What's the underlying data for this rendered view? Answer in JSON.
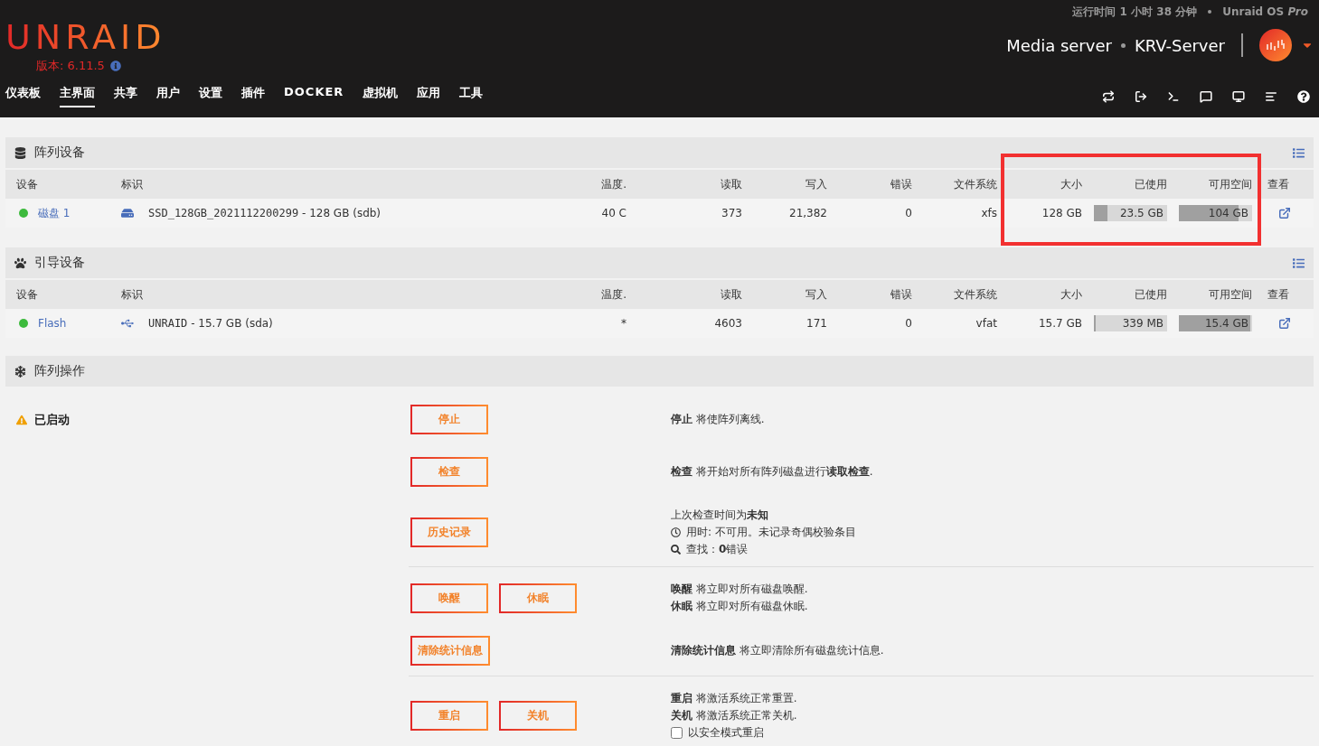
{
  "header": {
    "uptime": "运行时间 1 小时 38 分钟",
    "edition": "Unraid OS ",
    "edition_tier": "Pro",
    "logo": "UNRAID",
    "version": "版本: 6.11.5",
    "server_description": "Media server",
    "server_name": "KRV-Server"
  },
  "nav": [
    {
      "label": "仪表板",
      "selected": false
    },
    {
      "label": "主界面",
      "selected": true
    },
    {
      "label": "共享",
      "selected": false
    },
    {
      "label": "用户",
      "selected": false
    },
    {
      "label": "设置",
      "selected": false
    },
    {
      "label": "插件",
      "selected": false
    },
    {
      "label": "DOCKER",
      "selected": false
    },
    {
      "label": "虚拟机",
      "selected": false
    },
    {
      "label": "应用",
      "selected": false
    },
    {
      "label": "工具",
      "selected": false
    }
  ],
  "sections": [
    {
      "title": "阵列设备",
      "kind": "array",
      "highlighted": true,
      "columns": [
        "设备",
        "标识",
        "温度.",
        "读取",
        "写入",
        "错误",
        "文件系统",
        "大小",
        "已使用",
        "可用空间",
        "查看"
      ],
      "rows": [
        {
          "device": "磁盘 1",
          "color": "#3dba3d",
          "kind": "ssd",
          "identity": "SSD_128GB_2021112200299",
          "identity_suffix": " - 128 GB (sdb)",
          "temp": "40 C",
          "reads": "373",
          "writes": "21,382",
          "errors": "0",
          "fs": "xfs",
          "size": "128 GB",
          "used": {
            "text": "23.5 GB",
            "level": 0.18
          },
          "free": {
            "text": "104 GB",
            "level": 0.81
          }
        }
      ]
    },
    {
      "title": "引导设备",
      "kind": "boot",
      "highlighted": false,
      "columns": [
        "设备",
        "标识",
        "温度.",
        "读取",
        "写入",
        "错误",
        "文件系统",
        "大小",
        "已使用",
        "可用空间",
        "查看"
      ],
      "rows": [
        {
          "device": "Flash",
          "color": "#3dba3d",
          "kind": "usb",
          "identity": "UNRAID",
          "identity_suffix": " - 15.7 GB (sda)",
          "temp": "*",
          "reads": "4603",
          "writes": "171",
          "errors": "0",
          "fs": "vfat",
          "size": "15.7 GB",
          "used": {
            "text": "339 MB",
            "level": 0.02
          },
          "free": {
            "text": "15.4 GB",
            "level": 0.98
          }
        }
      ]
    }
  ],
  "operations": {
    "title": "阵列操作",
    "status": "已启动",
    "groups": [
      {
        "rows": [
          {
            "buttons": [
              "停止"
            ],
            "lines": [
              {
                "kind": "text",
                "text": "**停止** 将使阵列离线."
              }
            ]
          },
          {
            "buttons": [
              "检查"
            ],
            "lines": [
              {
                "kind": "text",
                "text": "**检查** 将开始对所有阵列磁盘进行**读取检查**."
              }
            ]
          },
          {
            "buttons": [
              "历史记录"
            ],
            "lines": [
              {
                "kind": "text",
                "text": "上次检查时间为**未知**"
              },
              {
                "kind": "clock",
                "text": "用时: 不可用。未记录奇偶校验条目"
              },
              {
                "kind": "search",
                "text": "查找：**0**错误"
              }
            ]
          }
        ]
      },
      {
        "rows": [
          {
            "buttons": [
              "唤醒",
              "休眠"
            ],
            "lines": [
              {
                "kind": "text",
                "text": "**唤醒** 将立即对所有磁盘唤醒."
              },
              {
                "kind": "text",
                "text": "**休眠** 将立即对所有磁盘休眠."
              }
            ]
          },
          {
            "buttons": [
              "清除统计信息"
            ],
            "lines": [
              {
                "kind": "text",
                "text": "**清除统计信息** 将立即清除所有磁盘统计信息."
              }
            ]
          }
        ]
      },
      {
        "rows": [
          {
            "buttons": [
              "重启",
              "关机"
            ],
            "lines": [
              {
                "kind": "text",
                "text": "**重启** 将激活系统正常重置."
              },
              {
                "kind": "text",
                "text": "**关机** 将激活系统正常关机."
              },
              {
                "kind": "checkbox",
                "text": "以安全模式重启",
                "checked": false
              }
            ]
          }
        ]
      }
    ]
  }
}
